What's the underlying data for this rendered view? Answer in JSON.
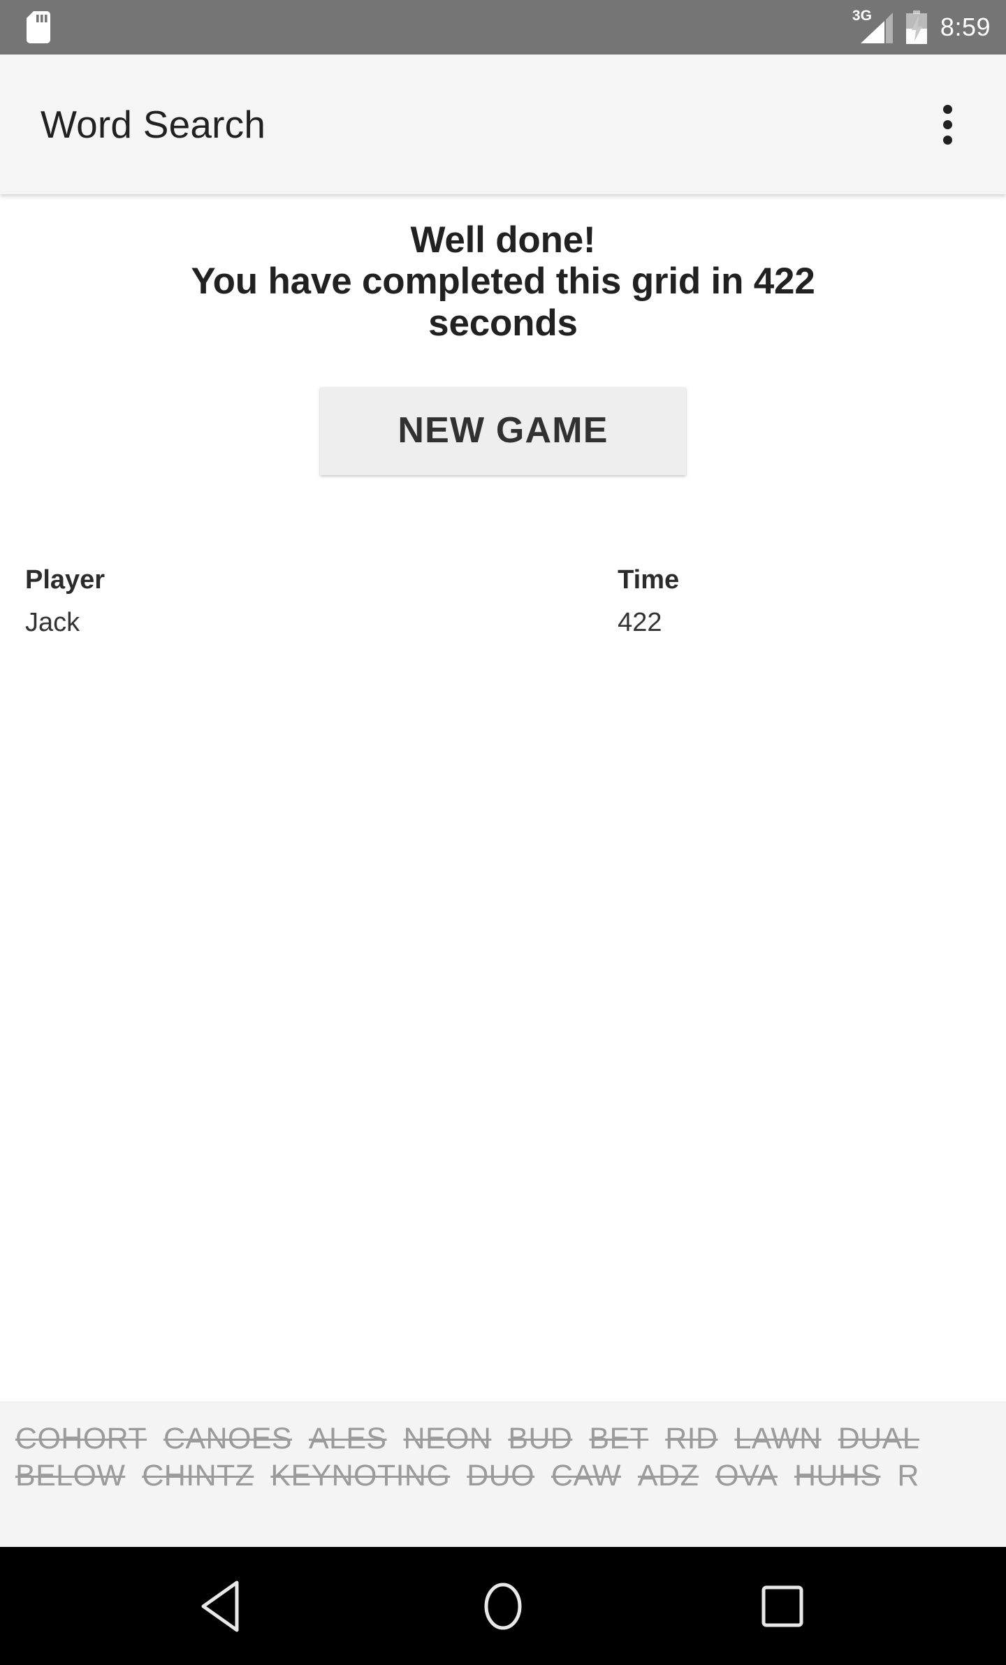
{
  "status_bar": {
    "sd_card_icon": "sd-card-icon",
    "network_label": "3G",
    "signal_icon": "signal-bars-icon",
    "battery_icon": "battery-charging-icon",
    "clock": "8:59",
    "background_color": "#757575"
  },
  "app_bar": {
    "title": "Word Search",
    "overflow_icon": "overflow-menu-icon",
    "background_color": "#f5f5f5",
    "title_color": "#212121"
  },
  "main": {
    "message_line1": "Well done!",
    "message_line2": "You have completed this grid in 422",
    "message_line3": "seconds",
    "new_game_label": "NEW GAME",
    "scores": {
      "headers": [
        "Player",
        "Time"
      ],
      "rows": [
        {
          "player": "Jack",
          "time": "422"
        }
      ]
    }
  },
  "word_list": {
    "rows": [
      [
        {
          "text": "COHORT",
          "found": true
        },
        {
          "text": "CANOES",
          "found": true
        },
        {
          "text": "ALES",
          "found": true
        },
        {
          "text": "NEON",
          "found": true
        },
        {
          "text": "BUD",
          "found": true
        },
        {
          "text": "BET",
          "found": true
        },
        {
          "text": "RID",
          "found": true
        },
        {
          "text": "LAWN",
          "found": true
        },
        {
          "text": "DUAL",
          "found": true
        }
      ],
      [
        {
          "text": "BELOW",
          "found": true
        },
        {
          "text": "CHINTZ",
          "found": true
        },
        {
          "text": "KEYNOTING",
          "found": true
        },
        {
          "text": "DUO",
          "found": true
        },
        {
          "text": "CAW",
          "found": true
        },
        {
          "text": "ADZ",
          "found": true
        },
        {
          "text": "OVA",
          "found": true
        },
        {
          "text": "HUHS",
          "found": true
        },
        {
          "text": "R",
          "found": false
        }
      ]
    ],
    "background_color": "#f4f4f4",
    "text_color": "#9b9b9b"
  },
  "nav_bar": {
    "back_icon": "back-triangle-icon",
    "home_icon": "home-circle-icon",
    "recents_icon": "recents-square-icon",
    "background_color": "#000000"
  }
}
